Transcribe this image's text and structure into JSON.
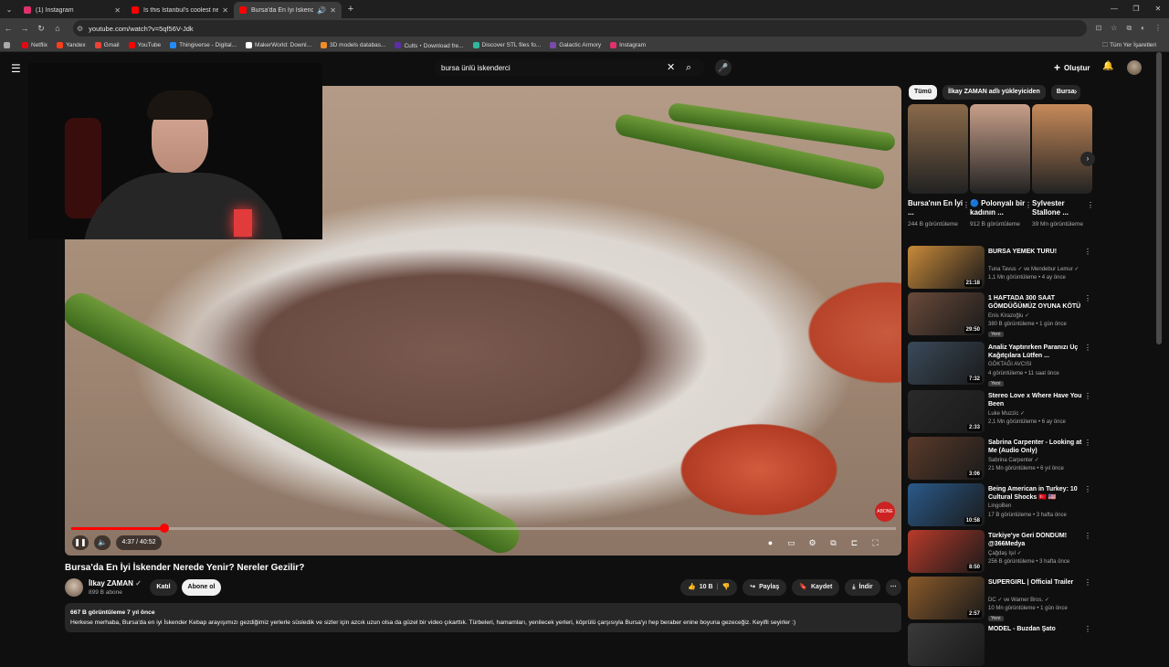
{
  "browser": {
    "tabs": [
      {
        "title": "(1) Instagram",
        "color": "#e1306c"
      },
      {
        "title": "Is this Istanbul's coolest neigh",
        "color": "#ff0000"
      },
      {
        "title": "Bursa'da En İyi İskender Ne",
        "color": "#ff0000"
      }
    ],
    "url": "youtube.com/watch?v=5qf56V-Jdk",
    "bookmarks": [
      "Netflix",
      "Yandex",
      "Gmail",
      "YouTube",
      "Thingiverse - Digital...",
      "MakerWorld: Downl...",
      "3D models databas...",
      "Cults・Download fre...",
      "Discover STL files fo...",
      "Galactic Armory",
      "Instagram"
    ],
    "bookmarks_all": "Tüm Yer İşaretleri"
  },
  "yt": {
    "search_query": "bursa ünlü iskenderci",
    "create_label": "Oluştur"
  },
  "player": {
    "time": "4:37 / 40:52",
    "progress": 0.113
  },
  "video": {
    "title": "Bursa'da En İyi İskender Nerede Yenir? Nereler Gezilir?",
    "channel": "İlkay ZAMAN",
    "subs": "899 B abone",
    "join_label": "Katıl",
    "subscribe_label": "Abone ol",
    "likes": "10 B",
    "share_label": "Paylaş",
    "save_label": "Kaydet",
    "download_label": "İndir",
    "views_date": "667 B görüntüleme  7 yıl önce",
    "description": "Herkese merhaba, Bursa'da en iyi İskender Kebap arayışımızı gezdiğimiz yerlerle süsledik ve sizler için azcık uzun olsa da güzel bir video çıkarttık. Türbeleri, hamamları, yenilecek yerleri, köprülü çarşısıyla Bursa'yı hep beraber enine boyuna gezeceğiz. Keyifli seyirler :)"
  },
  "sidebar": {
    "chips": [
      "Tümü",
      "İlkay ZAMAN adlı yükleyiciden",
      "Bursa"
    ],
    "shorts": [
      {
        "title": "Bursa'nın En İyi ...",
        "views": "244 B görüntüleme",
        "color": "#8a6a4a"
      },
      {
        "title": "🔵 Polonyalı bir kadının ...",
        "views": "912 B görüntüleme",
        "color": "#c9a08a"
      },
      {
        "title": "Sylvester Stallone ...",
        "views": "39 Mn görüntüleme",
        "color": "#c78a5a"
      }
    ],
    "recs": [
      {
        "title": "BURSA YEMEK TURU!",
        "channel": "Tuna Tavus ✓ ve Mendebur Lemur ✓",
        "meta": "1,1 Mn görüntüleme • 4 ay önce",
        "dur": "21:18",
        "color": "#c98a3a",
        "new": ""
      },
      {
        "title": "1 HAFTADA 300 SAAT GÖMDÜĞÜMÜZ OYUNA KÖTÜ ...",
        "channel": "Enis Kirazoğlu ✓",
        "meta": "380 B görüntüleme • 1 gün önce",
        "dur": "29:50",
        "color": "#6a4a3a",
        "new": "Yeni"
      },
      {
        "title": "Analiz Yaptırırken Paranızı Üç Kağıtçılara Lütfen ...",
        "channel": "GÖKTAĞI AVCISI",
        "meta": "4 görüntüleme • 11 saat önce",
        "dur": "7:32",
        "color": "#3a4a5a",
        "new": "Yeni"
      },
      {
        "title": "Stereo Love x Where Have You Been",
        "channel": "Luke Muzzic ✓",
        "meta": "2,1 Mn görüntüleme • 6 ay önce",
        "dur": "2:33",
        "color": "#2a2a2a",
        "new": ""
      },
      {
        "title": "Sabrina Carpenter - Looking at Me (Audio Only)",
        "channel": "Sabrina Carpenter ✓",
        "meta": "21 Mn görüntüleme • 6 yıl önce",
        "dur": "3:06",
        "color": "#5a3a2a",
        "new": ""
      },
      {
        "title": "Being American in Turkey: 10 Cultural Shocks 🇹🇷 🇺🇸",
        "channel": "LingoBen",
        "meta": "17 B görüntüleme • 3 hafta önce",
        "dur": "10:58",
        "color": "#2a5a8a",
        "new": ""
      },
      {
        "title": "Türkiye'ye Geri DÖNDÜM! @366Medya",
        "channel": "Çağdaş Işıl ✓",
        "meta": "256 B görüntüleme • 3 hafta önce",
        "dur": "8:50",
        "color": "#b83a2a",
        "new": ""
      },
      {
        "title": "SUPERGIRL | Official Trailer",
        "channel": "DC ✓ ve Warner Bros. ✓",
        "meta": "10 Mn görüntüleme • 1 gün önce",
        "dur": "2:57",
        "color": "#8a5a2a",
        "new": "Yeni"
      },
      {
        "title": "MODEL - Buzdan Şato",
        "channel": "",
        "meta": "",
        "dur": "",
        "color": "#3a3a3a",
        "new": ""
      }
    ]
  }
}
